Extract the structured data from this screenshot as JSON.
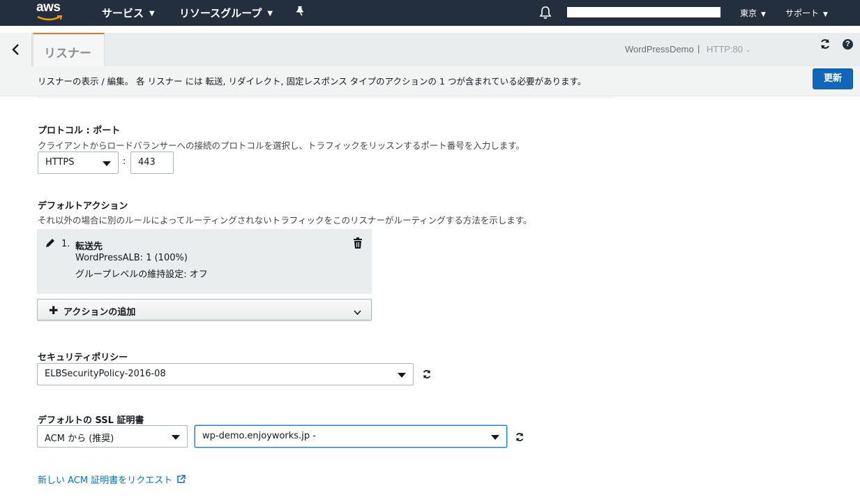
{
  "topnav": {
    "logo_text": "aws",
    "services_label": "サービス",
    "resource_groups_label": "リソースグループ",
    "region_label": "東京",
    "support_label": "サポート",
    "icons": [
      "pin-icon",
      "bell-icon",
      "chevron-down-icon"
    ]
  },
  "header": {
    "tab_label": "リスナー",
    "load_balancer_name": "WordPressDemo",
    "separator": "|",
    "listener_selector": "HTTP:80"
  },
  "infobar": {
    "message": "リスナーの表示 / 編集。 各 リスナー には 転送, リダイレクト, 固定レスポンス タイプのアクションの 1 つが含まれている必要があります。",
    "update_button": "更新"
  },
  "protocol": {
    "label": "プロトコル : ポート",
    "description": "クライアントからロードバランサーへの接続のプロトコルを選択し、トラフィックをリッスンするポート番号を入力します。",
    "protocol_value": "HTTPS",
    "separator": ":",
    "port_value": "443"
  },
  "default_action": {
    "label": "デフォルトアクション",
    "description": "それ以外の場合に別のルールによってルーティングされないトラフィックをこのリスナーがルーティングする方法を示します。",
    "item_number": "1.",
    "item_title": "転送先",
    "target_line": "WordPressALB: 1 (100%)",
    "stickiness_line": "グループレベルの維持設定: オフ",
    "add_action_label": "アクションの追加"
  },
  "security_policy": {
    "label": "セキュリティポリシー",
    "value": "ELBSecurityPolicy-2016-08"
  },
  "ssl_certificate": {
    "label": "デフォルトの SSL 証明書",
    "source_value": "ACM から (推奨)",
    "certificate_value": "wp-demo.enjoyworks.jp -"
  },
  "request_link": {
    "label": "新しい ACM 証明書をリクエスト"
  },
  "colors": {
    "nav_bg": "#232f3e",
    "primary_button": "#1166bb",
    "tab_accent": "#e07b23",
    "link": "#0073bb"
  }
}
